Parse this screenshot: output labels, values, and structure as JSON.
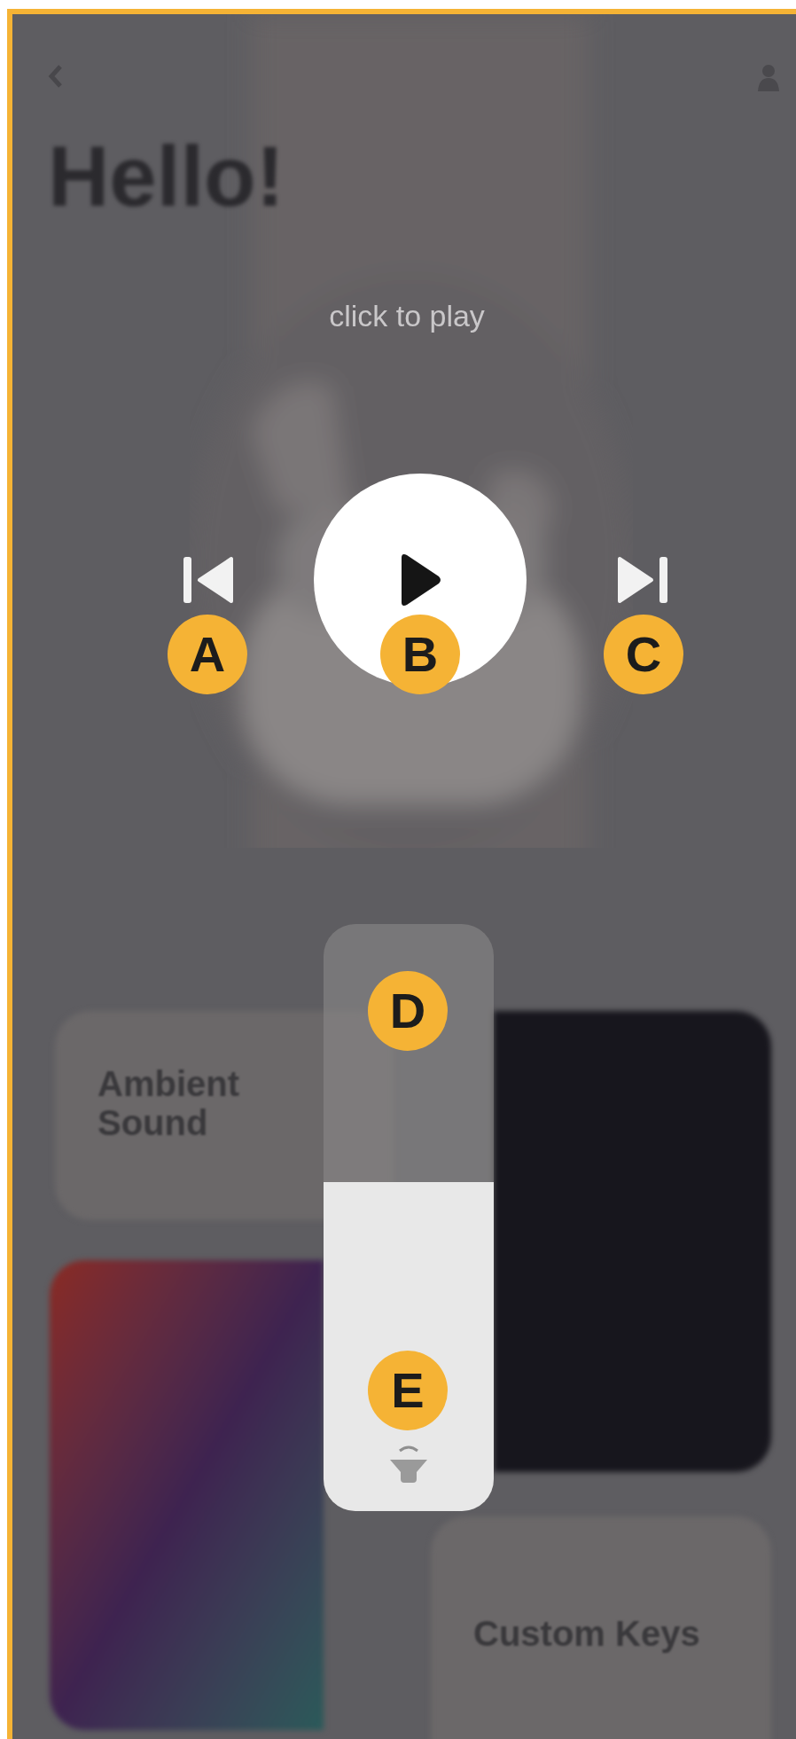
{
  "title": "Hello!",
  "hint": "click to play",
  "controls": [
    {
      "kind": "previous",
      "badge": "A"
    },
    {
      "kind": "play",
      "badge": "B"
    },
    {
      "kind": "next",
      "badge": "C"
    }
  ],
  "volume": {
    "level": 0.56,
    "badges": [
      "D",
      "E"
    ]
  },
  "cards": [
    {
      "kind": "plain",
      "title": "Ambient Sound"
    },
    {
      "kind": "dark"
    },
    {
      "kind": "gradient"
    },
    {
      "kind": "plain",
      "title": "Custom Keys"
    }
  ]
}
